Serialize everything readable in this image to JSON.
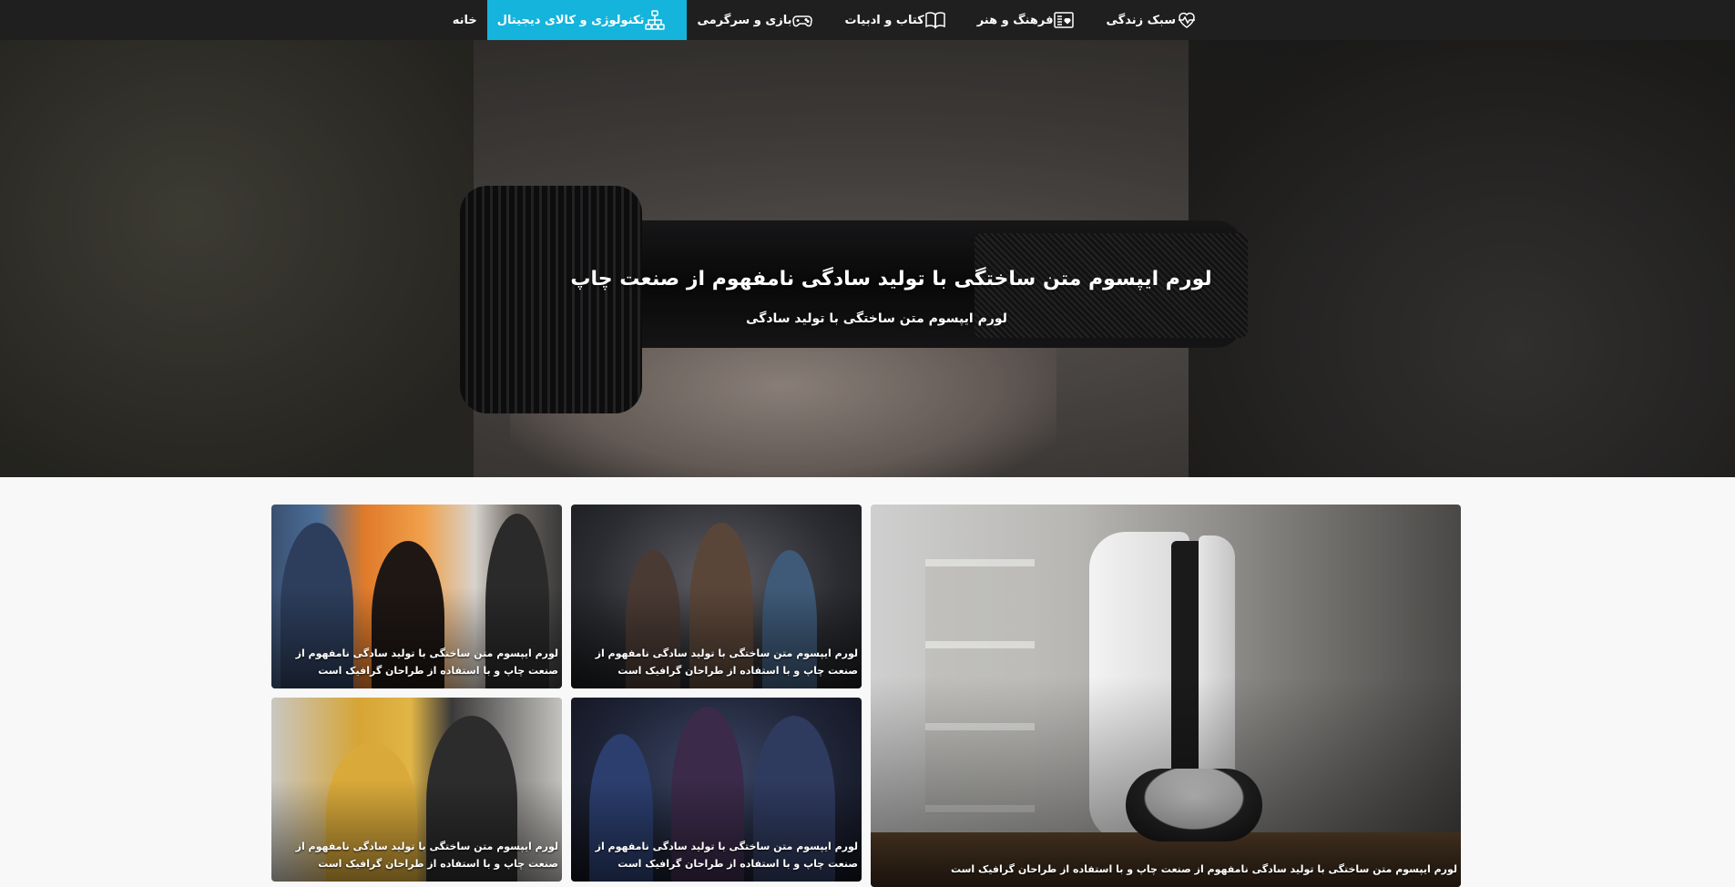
{
  "nav": {
    "items": [
      {
        "label": "خانه",
        "icon": "",
        "active": false
      },
      {
        "label": "تکنولوژی و کالای دیجیتال",
        "icon": "sitemap-icon",
        "active": true
      },
      {
        "label": "بازی و سرگرمی",
        "icon": "gamepad-icon",
        "active": false
      },
      {
        "label": "کتاب و ادبیات",
        "icon": "book-icon",
        "active": false
      },
      {
        "label": "فرهنگ و هنر",
        "icon": "art-icon",
        "active": false
      },
      {
        "label": "سبک زندگی",
        "icon": "heartbeat-icon",
        "active": false
      }
    ],
    "colors": {
      "bar": "#1f1f1f",
      "active": "#14b4dc"
    }
  },
  "hero": {
    "title": "لورم ایپسوم متن ساختگی با تولید سادگی نامفهوم از صنعت چاپ",
    "subtitle": "لورم ایپسوم متن ساختگی با تولید سادگی"
  },
  "cards": {
    "big": {
      "caption": "لورم ایپسوم متن ساختگی با تولید سادگی نامفهوم از صنعت چاپ و با استفاده از طراحان گرافیک است"
    },
    "c1": {
      "caption": "لورم ایپسوم متن ساختگی با تولید سادگی نامفهوم از صنعت چاپ و با استفاده از طراحان گرافیک است"
    },
    "c2": {
      "caption": "لورم ایپسوم متن ساختگی با تولید سادگی نامفهوم از صنعت چاپ و با استفاده از طراحان گرافیک است"
    },
    "c3": {
      "caption": "لورم ایپسوم متن ساختگی با تولید سادگی نامفهوم از صنعت چاپ و با استفاده از طراحان گرافیک است"
    },
    "c4": {
      "caption": "لورم ایپسوم متن ساختگی با تولید سادگی نامفهوم از صنعت چاپ و با استفاده از طراحان گرافیک است"
    }
  }
}
